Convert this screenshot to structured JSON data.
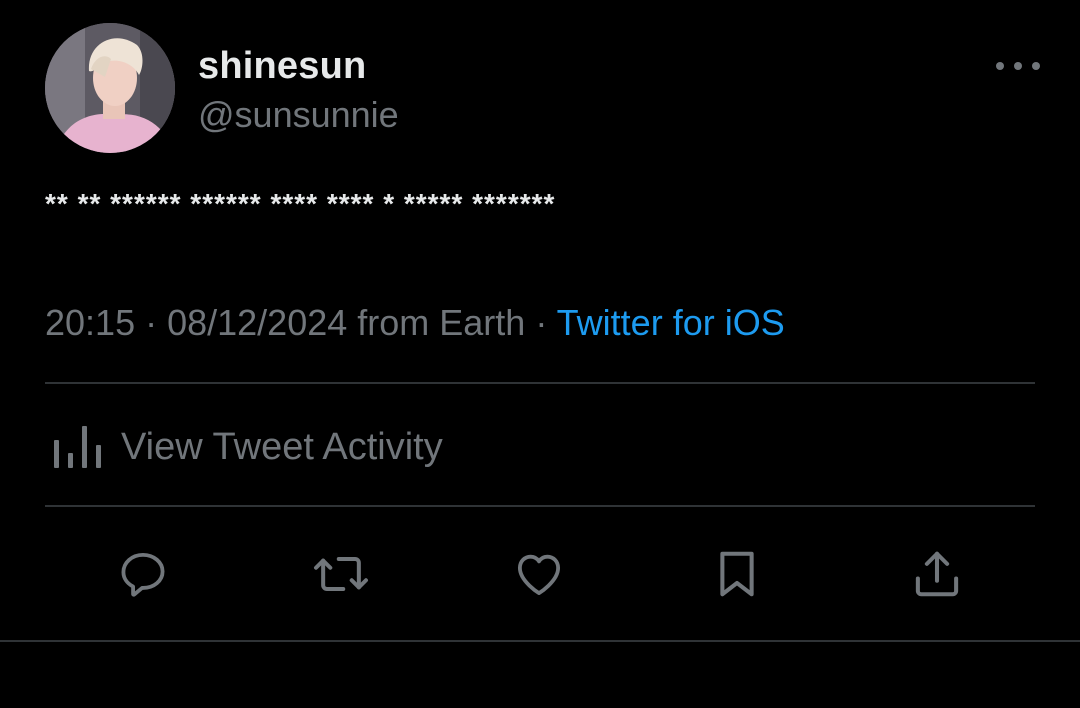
{
  "user": {
    "display_name": "shinesun",
    "handle": "@sunsunnie"
  },
  "tweet": {
    "text": "** ** ****** ****** **** **** * ***** *******",
    "time": "20:15",
    "separator1": " · ",
    "date": "08/12/2024 from Earth",
    "separator2": " · ",
    "source": "Twitter for iOS"
  },
  "activity": {
    "label": "View Tweet Activity",
    "icon": "bar-chart-icon"
  },
  "actions": [
    {
      "name": "reply",
      "icon": "reply-icon"
    },
    {
      "name": "retweet",
      "icon": "retweet-icon"
    },
    {
      "name": "like",
      "icon": "heart-icon"
    },
    {
      "name": "bookmark",
      "icon": "bookmark-icon"
    },
    {
      "name": "share",
      "icon": "share-icon"
    }
  ],
  "colors": {
    "background": "#000000",
    "text_primary": "#e7e9ea",
    "text_secondary": "#71767b",
    "link": "#1d9bf0",
    "divider": "#2f3336"
  }
}
